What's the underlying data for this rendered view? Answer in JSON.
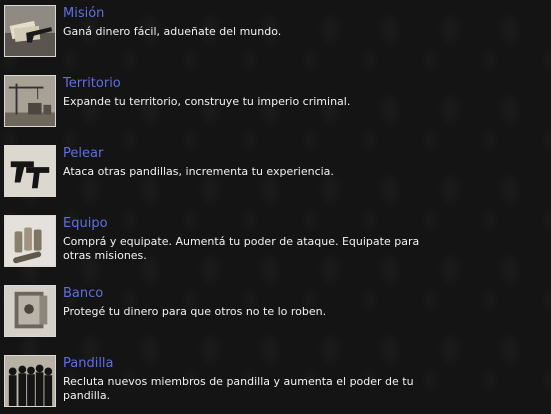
{
  "items": [
    {
      "title": "Misión",
      "desc": "Ganá dinero fácil, adueñate del mundo.",
      "icon": "money-gun-icon"
    },
    {
      "title": "Territorio",
      "desc": "Expande tu territorio, construye tu imperio criminal.",
      "icon": "construction-crane-icon"
    },
    {
      "title": "Pelear",
      "desc": "Ataca otras pandillas, incrementa tu experiencia.",
      "icon": "pistols-icon"
    },
    {
      "title": "Equipo",
      "desc": "Comprá y equipate. Aumentá tu poder de ataque. Equipate para otras misiones.",
      "icon": "bullets-icon"
    },
    {
      "title": "Banco",
      "desc": "Protegé tu dinero para que otros no te lo roben.",
      "icon": "safe-icon"
    },
    {
      "title": "Pandilla",
      "desc": "Recluta nuevos miembros de pandilla y aumenta el poder de tu pandilla.",
      "icon": "gang-silhouette-icon"
    }
  ]
}
